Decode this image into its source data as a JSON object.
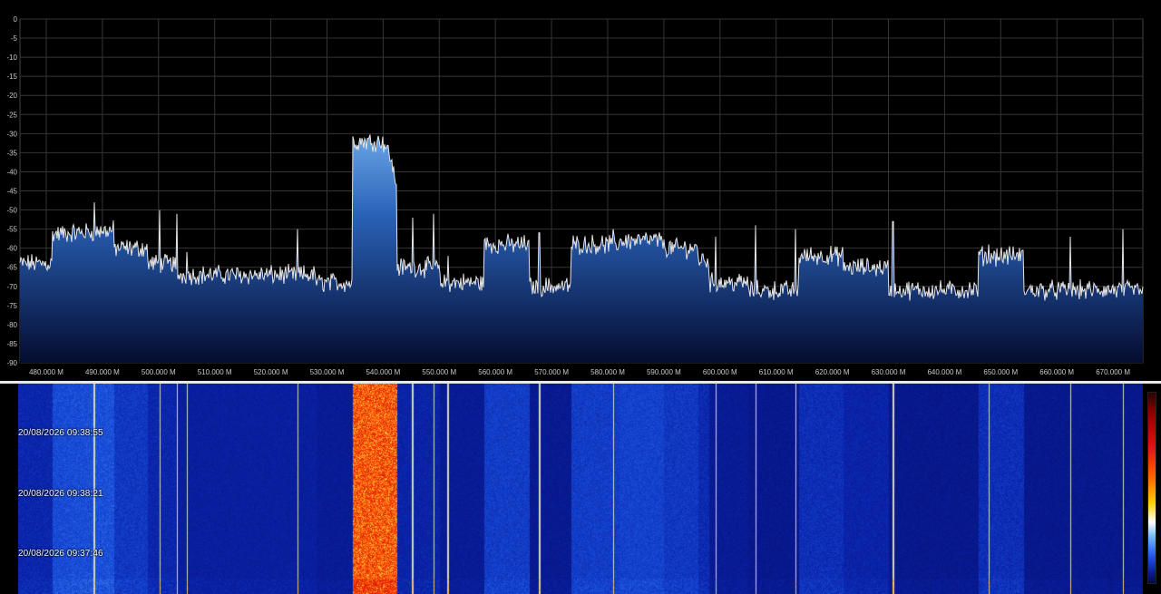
{
  "spectrum": {
    "y_ticks": [
      "0",
      "-5",
      "-10",
      "-15",
      "-20",
      "-25",
      "-30",
      "-35",
      "-40",
      "-45",
      "-50",
      "-55",
      "-60",
      "-65",
      "-70",
      "-75",
      "-80",
      "-85",
      "-90"
    ],
    "x_ticks": [
      "480.000 M",
      "490.000 M",
      "500.000 M",
      "510.000 M",
      "520.000 M",
      "530.000 M",
      "540.000 M",
      "550.000 M",
      "560.000 M",
      "570.000 M",
      "580.000 M",
      "590.000 M",
      "600.000 M",
      "610.000 M",
      "620.000 M",
      "630.000 M",
      "640.000 M",
      "650.000 M",
      "660.000 M",
      "670.000 M"
    ],
    "colors": {
      "background": "#000000",
      "grid": "#3a3a3a",
      "trace": "#e6e6e6",
      "fill_top": "#5a8fd0",
      "fill_bottom": "#05103a",
      "label": "#c8c8c8"
    }
  },
  "waterfall": {
    "timestamps": [
      "20/08/2026 09:38:55",
      "20/08/2026 09:38:21",
      "20/08/2026 09:37:46"
    ],
    "colors": {
      "low": "#0a1a8c",
      "mid": "#1c57e8",
      "high": "#ff2a00"
    }
  }
}
